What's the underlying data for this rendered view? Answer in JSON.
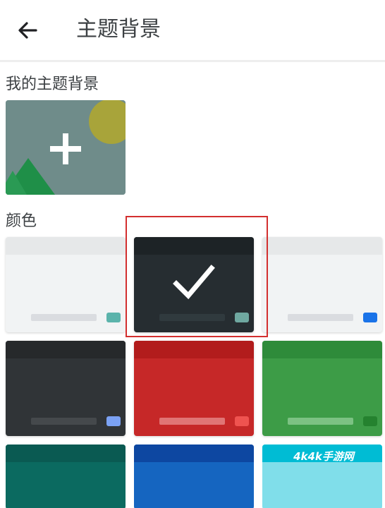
{
  "appbar": {
    "title": "主题背景",
    "back_icon": "arrow-left-icon"
  },
  "my_themes": {
    "label": "我的主题背景",
    "add_icon": "plus-icon"
  },
  "colors": {
    "label": "颜色",
    "selected_index": 1,
    "selection_highlight": "#d32f2f",
    "swatches": [
      {
        "name": "light",
        "bar": "#e6e8e9",
        "body": "#f1f3f4",
        "line": "#dadce0",
        "chip": "#5bb3ab"
      },
      {
        "name": "dark-slate",
        "bar": "#1d2326",
        "body": "#262d31",
        "line": "#303a3e",
        "chip": "#6fa8a0"
      },
      {
        "name": "light-blue-accent",
        "bar": "#e6e8e9",
        "body": "#f1f3f4",
        "line": "#dadce0",
        "chip": "#1a73e8"
      },
      {
        "name": "dark-gray",
        "bar": "#26292b",
        "body": "#303437",
        "line": "#45494c",
        "chip": "#7ba2f4"
      },
      {
        "name": "red",
        "bar": "#b21c1c",
        "body": "#c62828",
        "line": "#e07575",
        "chip": "#ef5350"
      },
      {
        "name": "green",
        "bar": "#2e8b3a",
        "body": "#3d9c47",
        "line": "#7cc283",
        "chip": "#25822f"
      },
      {
        "name": "teal",
        "bar": "#0a5a52",
        "body": "#0b6a60"
      },
      {
        "name": "blue",
        "bar": "#0d47a1",
        "body": "#1565c0"
      },
      {
        "name": "cyan",
        "bar": "#00bcd4",
        "body": "#80deea"
      }
    ]
  },
  "watermark": "4k4k手游网"
}
